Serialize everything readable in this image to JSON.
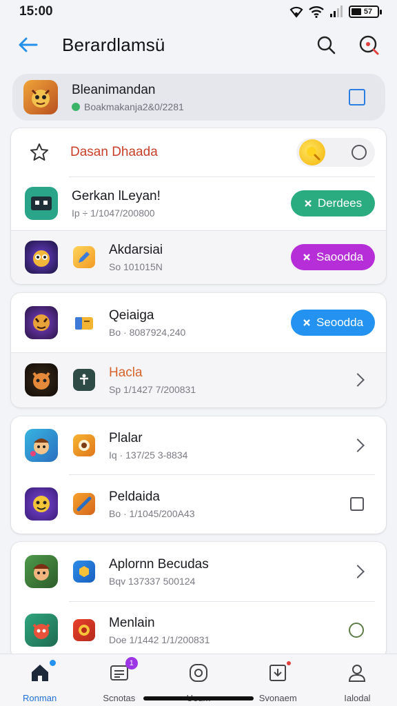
{
  "status_bar": {
    "time": "15:00",
    "battery": "57"
  },
  "header": {
    "title": "Berardlamsü"
  },
  "featured": {
    "title": "Bleanimandan",
    "subtitle": "Boakmakanja2&0/2281"
  },
  "card1": {
    "rows": [
      {
        "title": "Dasan Dhaada"
      },
      {
        "title": "Gerkan lLeyan!",
        "subtitle": "Ip ÷ 1/1047/200800",
        "button": "Derdees"
      },
      {
        "title": "Akdarsiai",
        "subtitle": "So 101015N",
        "button": "Saoodda"
      }
    ]
  },
  "card2": {
    "rows": [
      {
        "title": "Qeiaiga",
        "subtitle": "Bo · 8087924,240",
        "button": "Seoodda"
      },
      {
        "title": "Hacla",
        "subtitle": "Sp 1/1427 7/200831"
      }
    ]
  },
  "card3": {
    "rows": [
      {
        "title": "Plalar",
        "subtitle": "Iq · 137/25 3-8834"
      },
      {
        "title": "Peldaida",
        "subtitle": "Bo · 1/1045/200A43"
      }
    ]
  },
  "card4": {
    "rows": [
      {
        "title": "Aplornn Becudas",
        "subtitle": "Bqv 137337 500124"
      },
      {
        "title": "Menlain",
        "subtitle": "Doe 1/1442 1/1/200831"
      }
    ]
  },
  "bottom_nav": {
    "items": [
      {
        "label": "Ronman"
      },
      {
        "label": "Scnotas",
        "badge": "1"
      },
      {
        "label": "Ueum"
      },
      {
        "label": "Svonaem"
      },
      {
        "label": "Ialodal"
      }
    ]
  },
  "colors": {
    "accent_blue": "#2392f0",
    "green_button": "#2bab80",
    "purple_button": "#b62ed8",
    "title_red": "#c8402a"
  }
}
